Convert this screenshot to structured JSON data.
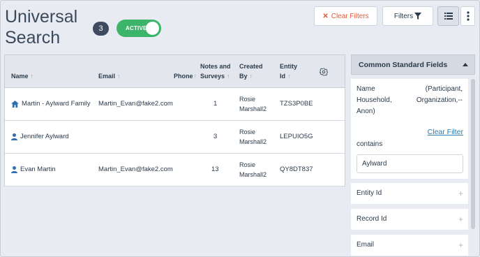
{
  "header": {
    "title_line1": "Universal",
    "title_line2": "Search",
    "result_count": "3",
    "status_toggle_label": "ACTIVE",
    "clear_filters_label": "Clear Filters",
    "filters_label": "Filters"
  },
  "table": {
    "columns": {
      "name": "Name",
      "email": "Email",
      "phone": "Phone",
      "notes_line1": "Notes and",
      "notes_line2": "Surveys",
      "created_line1": "Created",
      "created_line2": "By",
      "entity_line1": "Entity",
      "entity_line2": "Id"
    },
    "rows": [
      {
        "icon": "home-icon",
        "name": "Martin - Aylward Family",
        "email": "Martin_Evan@fake2.com",
        "phone": "",
        "notes": "1",
        "created_line1": "Rosie",
        "created_line2": "Marshall2",
        "entity_id": "TZS3P0BE"
      },
      {
        "icon": "person-icon",
        "name": "Jennifer Aylward",
        "email": "",
        "phone": "",
        "notes": "3",
        "created_line1": "Rosie",
        "created_line2": "Marshall2",
        "entity_id": "LEPUIO5G"
      },
      {
        "icon": "person-icon",
        "name": "Evan Martin",
        "email": "Martin_Evan@fake2.com",
        "phone": "",
        "notes": "13",
        "created_line1": "Rosie",
        "created_line2": "Marshall2",
        "entity_id": "QY8DT837"
      }
    ]
  },
  "filter_panel": {
    "title": "Common Standard Fields",
    "name_field": {
      "line1": "Name (Participant,",
      "line2": "Household, Organization,--",
      "line3": "Anon)",
      "clear_filter_label": "Clear Filter",
      "operator": "contains",
      "value": "Aylward"
    },
    "fields": [
      {
        "label": "Entity Id"
      },
      {
        "label": "Record Id"
      },
      {
        "label": "Email"
      }
    ]
  },
  "colors": {
    "active_toggle": "#3cb46a",
    "clear_filters_text": "#e05a3a",
    "link": "#2a7ab0",
    "badge": "#3e4b5e"
  }
}
